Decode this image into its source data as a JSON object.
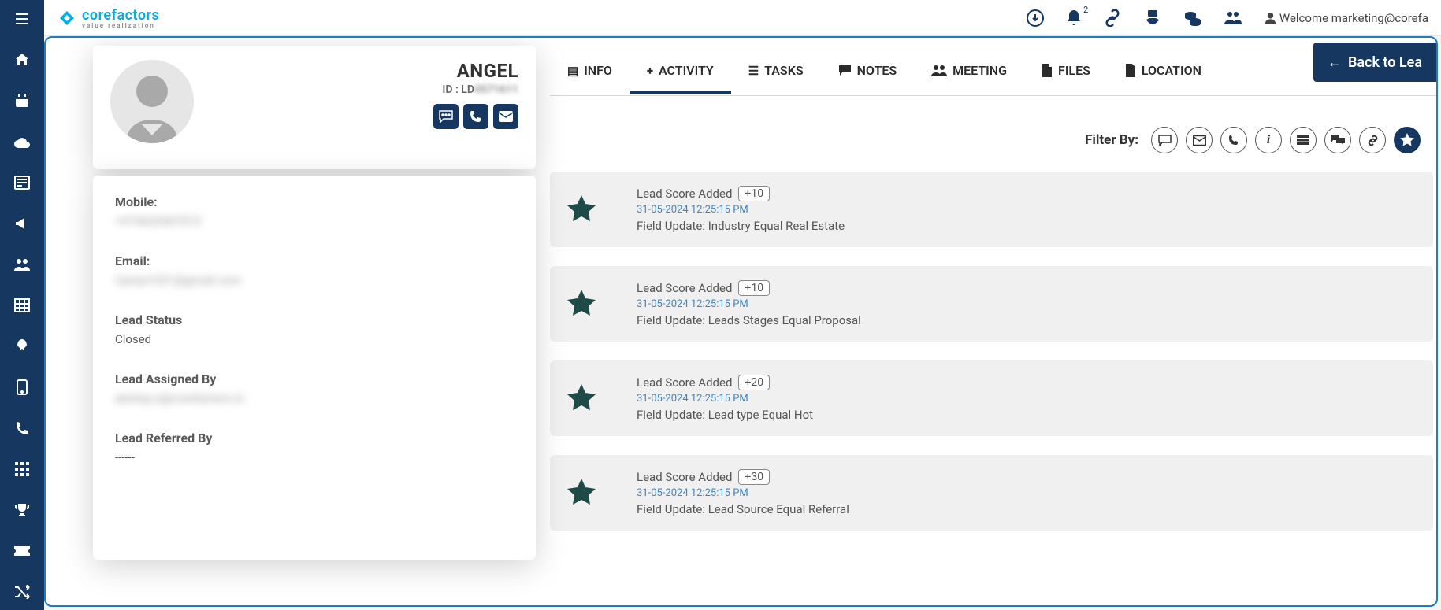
{
  "topbar": {
    "logo_main": "corefactors",
    "logo_sub": "value realization",
    "notification_count": "2",
    "welcome": "Welcome marketing@corefa"
  },
  "profile": {
    "name": "ANGEL",
    "id_prefix": "ID : LD",
    "id_blur": "0571611"
  },
  "details": {
    "mobile_label": "Mobile:",
    "mobile_value": "+919620407072",
    "email_label": "Email:",
    "email_value": "Cpriya1031@gmail.com",
    "lead_status_label": "Lead Status",
    "lead_status_value": "Closed",
    "assigned_label": "Lead Assigned By",
    "assigned_value": "akshay.s@corefactors.in",
    "referred_label": "Lead Referred By",
    "referred_value": "------"
  },
  "tabs": {
    "info": "INFO",
    "activity": "ACTIVITY",
    "tasks": "TASKS",
    "notes": "NOTES",
    "meeting": "MEETING",
    "files": "FILES",
    "location": "LOCATION",
    "back": "Back to Lea"
  },
  "filter_label": "Filter By:",
  "feed": [
    {
      "title": "Lead Score Added",
      "badge": "+10",
      "ts": "31-05-2024 12:25:15 PM",
      "desc": "Field Update: Industry Equal Real Estate"
    },
    {
      "title": "Lead Score Added",
      "badge": "+10",
      "ts": "31-05-2024 12:25:15 PM",
      "desc": "Field Update: Leads Stages Equal Proposal"
    },
    {
      "title": "Lead Score Added",
      "badge": "+20",
      "ts": "31-05-2024 12:25:15 PM",
      "desc": "Field Update: Lead type Equal Hot"
    },
    {
      "title": "Lead Score Added",
      "badge": "+30",
      "ts": "31-05-2024 12:25:15 PM",
      "desc": "Field Update: Lead Source Equal Referral"
    }
  ]
}
